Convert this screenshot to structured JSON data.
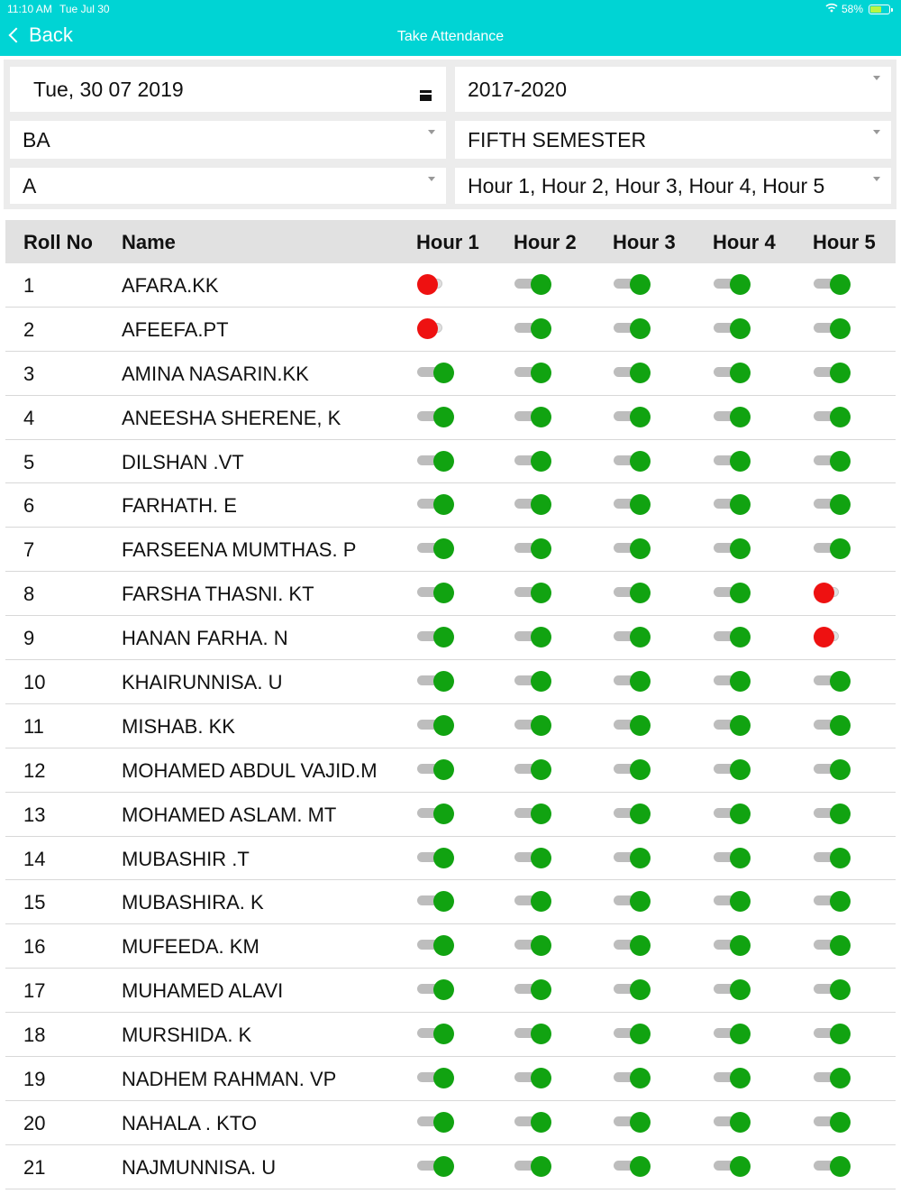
{
  "status_bar": {
    "time": "11:10 AM",
    "date": "Tue Jul 30",
    "battery": "58%"
  },
  "nav": {
    "back_label": "Back",
    "title": "Take Attendance"
  },
  "filters": {
    "date": "Tue, 30 07 2019",
    "batch": "2017-2020",
    "course": "BA",
    "semester": "FIFTH SEMESTER",
    "division": "A",
    "hours": "Hour 1, Hour 2, Hour 3, Hour 4, Hour 5"
  },
  "table": {
    "headers": [
      "Roll No",
      "Name",
      "Hour 1",
      "Hour 2",
      "Hour 3",
      "Hour 4",
      "Hour 5"
    ],
    "rows": [
      {
        "roll": "1",
        "name": "AFARA.KK",
        "present": [
          false,
          true,
          true,
          true,
          true
        ]
      },
      {
        "roll": "2",
        "name": "AFEEFA.PT",
        "present": [
          false,
          true,
          true,
          true,
          true
        ]
      },
      {
        "roll": "3",
        "name": "AMINA NASARIN.KK",
        "present": [
          true,
          true,
          true,
          true,
          true
        ]
      },
      {
        "roll": "4",
        "name": "ANEESHA SHERENE, K",
        "present": [
          true,
          true,
          true,
          true,
          true
        ]
      },
      {
        "roll": "5",
        "name": "DILSHAN .VT",
        "present": [
          true,
          true,
          true,
          true,
          true
        ]
      },
      {
        "roll": "6",
        "name": "FARHATH. E",
        "present": [
          true,
          true,
          true,
          true,
          true
        ]
      },
      {
        "roll": "7",
        "name": "FARSEENA MUMTHAS. P",
        "present": [
          true,
          true,
          true,
          true,
          true
        ]
      },
      {
        "roll": "8",
        "name": "FARSHA THASNI. KT",
        "present": [
          true,
          true,
          true,
          true,
          false
        ]
      },
      {
        "roll": "9",
        "name": "HANAN FARHA. N",
        "present": [
          true,
          true,
          true,
          true,
          false
        ]
      },
      {
        "roll": "10",
        "name": "KHAIRUNNISA. U",
        "present": [
          true,
          true,
          true,
          true,
          true
        ]
      },
      {
        "roll": "11",
        "name": "MISHAB. KK",
        "present": [
          true,
          true,
          true,
          true,
          true
        ]
      },
      {
        "roll": "12",
        "name": "MOHAMED ABDUL VAJID.M",
        "present": [
          true,
          true,
          true,
          true,
          true
        ]
      },
      {
        "roll": "13",
        "name": "MOHAMED ASLAM. MT",
        "present": [
          true,
          true,
          true,
          true,
          true
        ]
      },
      {
        "roll": "14",
        "name": "MUBASHIR .T",
        "present": [
          true,
          true,
          true,
          true,
          true
        ]
      },
      {
        "roll": "15",
        "name": "MUBASHIRA. K",
        "present": [
          true,
          true,
          true,
          true,
          true
        ]
      },
      {
        "roll": "16",
        "name": "MUFEEDA. KM",
        "present": [
          true,
          true,
          true,
          true,
          true
        ]
      },
      {
        "roll": "17",
        "name": "MUHAMED ALAVI",
        "present": [
          true,
          true,
          true,
          true,
          true
        ]
      },
      {
        "roll": "18",
        "name": "MURSHIDA. K",
        "present": [
          true,
          true,
          true,
          true,
          true
        ]
      },
      {
        "roll": "19",
        "name": "NADHEM RAHMAN. VP",
        "present": [
          true,
          true,
          true,
          true,
          true
        ]
      },
      {
        "roll": "20",
        "name": "NAHALA . KTO",
        "present": [
          true,
          true,
          true,
          true,
          true
        ]
      },
      {
        "roll": "21",
        "name": "NAJMUNNISA. U",
        "present": [
          true,
          true,
          true,
          true,
          true
        ]
      }
    ]
  },
  "colors": {
    "accent": "#00d4d4",
    "present": "#11a311",
    "absent": "#ee1111"
  }
}
